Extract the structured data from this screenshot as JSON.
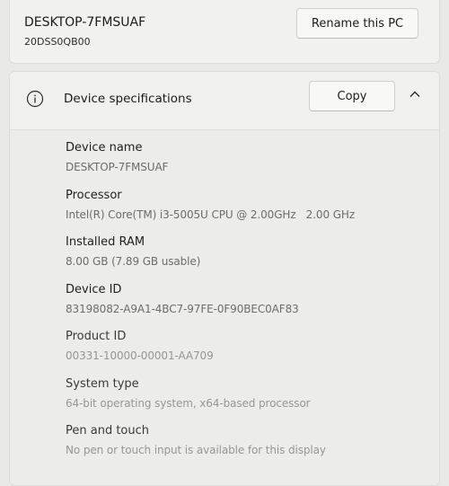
{
  "pc": {
    "name": "DESKTOP-7FMSUAF",
    "model": "20DSS0QB00",
    "rename_label": "Rename this PC"
  },
  "specs": {
    "title": "Device specifications",
    "copy_label": "Copy",
    "items": [
      {
        "label": "Device name",
        "value": "DESKTOP-7FMSUAF"
      },
      {
        "label": "Processor",
        "value": "Intel(R) Core(TM) i3-5005U CPU @ 2.00GHz   2.00 GHz"
      },
      {
        "label": "Installed RAM",
        "value": "8.00 GB (7.89 GB usable)"
      },
      {
        "label": "Device ID",
        "value": "83198082-A9A1-4BC7-97FE-0F90BEC0AF83"
      },
      {
        "label": "Product ID",
        "value": "00331-10000-00001-AA709"
      },
      {
        "label": "System type",
        "value": "64-bit operating system, x64-based processor"
      },
      {
        "label": "Pen and touch",
        "value": "No pen or touch input is available for this display"
      }
    ]
  },
  "icons": {
    "info": "info-icon",
    "collapse": "chevron-up-icon"
  }
}
